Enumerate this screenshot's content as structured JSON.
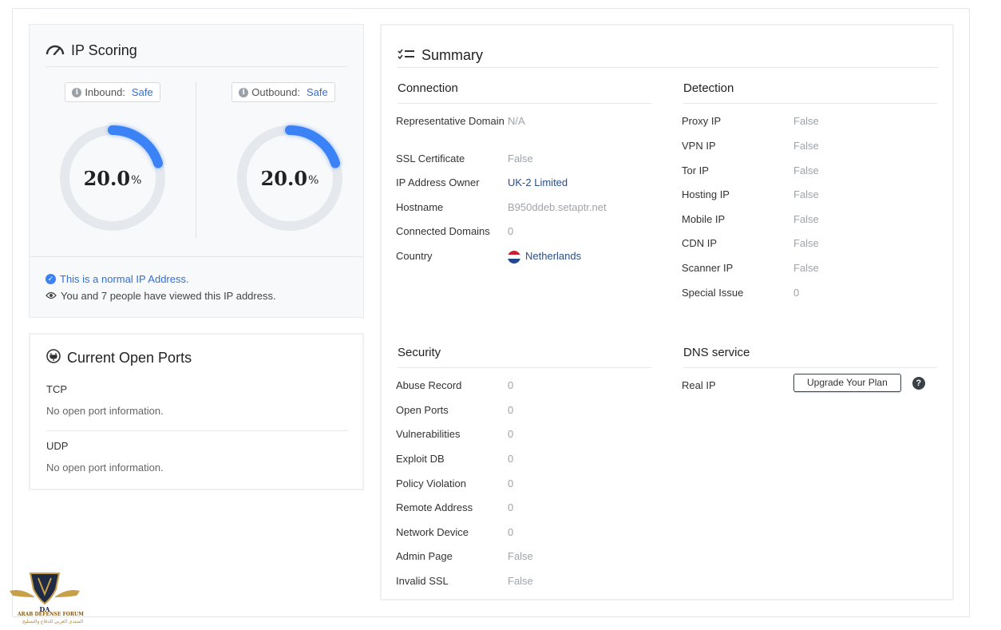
{
  "ip_scoring": {
    "title": "IP Scoring",
    "inbound": {
      "label": "Inbound:",
      "value": "Safe",
      "score": "20.0",
      "unit": "%",
      "fraction": 0.2
    },
    "outbound": {
      "label": "Outbound:",
      "value": "Safe",
      "score": "20.0",
      "unit": "%",
      "fraction": 0.2
    },
    "normal_text": "This is a normal IP Address.",
    "viewed_text": "You and 7 people have viewed this IP address."
  },
  "ports": {
    "title": "Current Open Ports",
    "tcp": {
      "label": "TCP",
      "text": "No open port information."
    },
    "udp": {
      "label": "UDP",
      "text": "No open port information."
    }
  },
  "summary": {
    "title": "Summary",
    "connection": {
      "title": "Connection",
      "rows": [
        {
          "key": "Representative Domain",
          "value": "N/A"
        },
        {
          "key": "SSL Certificate",
          "value": "False"
        },
        {
          "key": "IP Address Owner",
          "value": "UK-2 Limited"
        },
        {
          "key": "Hostname",
          "value": "B950ddeb.setaptr.net"
        },
        {
          "key": "Connected Domains",
          "value": "0"
        },
        {
          "key": "Country",
          "value": "Netherlands"
        }
      ]
    },
    "detection": {
      "title": "Detection",
      "rows": [
        {
          "key": "Proxy IP",
          "value": "False"
        },
        {
          "key": "VPN IP",
          "value": "False"
        },
        {
          "key": "Tor IP",
          "value": "False"
        },
        {
          "key": "Hosting IP",
          "value": "False"
        },
        {
          "key": "Mobile IP",
          "value": "False"
        },
        {
          "key": "CDN IP",
          "value": "False"
        },
        {
          "key": "Scanner IP",
          "value": "False"
        },
        {
          "key": "Special Issue",
          "value": "0"
        }
      ]
    },
    "security": {
      "title": "Security",
      "rows": [
        {
          "key": "Abuse Record",
          "value": "0"
        },
        {
          "key": "Open Ports",
          "value": "0"
        },
        {
          "key": "Vulnerabilities",
          "value": "0"
        },
        {
          "key": "Exploit DB",
          "value": "0"
        },
        {
          "key": "Policy Violation",
          "value": "0"
        },
        {
          "key": "Remote Address",
          "value": "0"
        },
        {
          "key": "Network Device",
          "value": "0"
        },
        {
          "key": "Admin Page",
          "value": "False"
        },
        {
          "key": "Invalid SSL",
          "value": "False"
        }
      ]
    },
    "dns": {
      "title": "DNS service",
      "real_ip_label": "Real IP",
      "upgrade_label": "Upgrade Your Plan",
      "help_glyph": "?"
    }
  },
  "watermark": {
    "line1": "ARAB DEFENSE FORUM",
    "line2": "المنتدى العربي للدفاع والتسليح",
    "monogram": "DA"
  },
  "colors": {
    "accent": "#3b82f6",
    "link": "#2f6fd8",
    "gauge_track": "#e5e9ee"
  }
}
